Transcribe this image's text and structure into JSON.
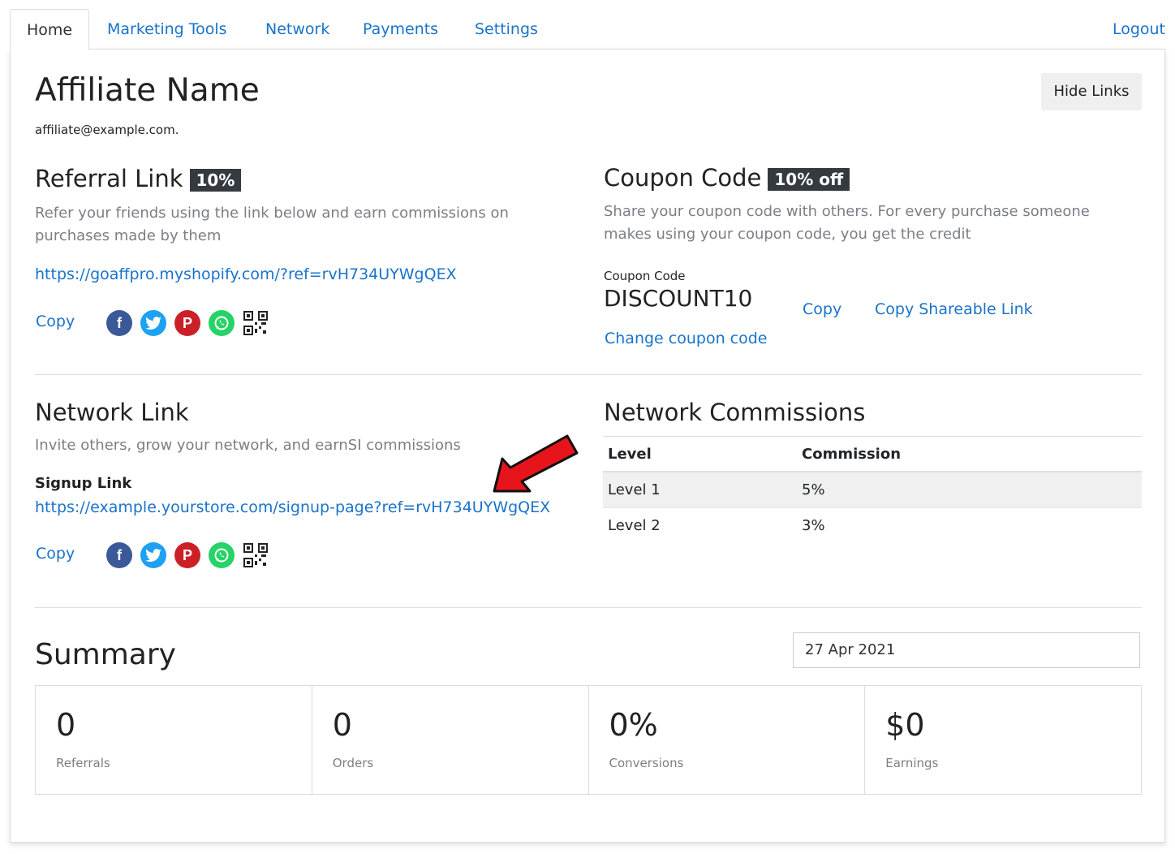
{
  "nav": {
    "tabs": [
      "Home",
      "Marketing Tools",
      "Network",
      "Payments",
      "Settings"
    ],
    "logout": "Logout"
  },
  "profile": {
    "name": "Affiliate Name",
    "email": "affiliate@example.com.",
    "hide_links": "Hide Links"
  },
  "referral": {
    "title": "Referral Link",
    "badge": "10%",
    "description": "Refer your friends using the link below and earn commissions on purchases made by them",
    "url": "https://goaffpro.myshopify.com/?ref=rvH734UYWgQEX",
    "copy": "Copy"
  },
  "coupon": {
    "title": "Coupon Code",
    "badge": "10% off",
    "description": "Share your coupon code with others. For every purchase someone makes using your coupon code, you get the credit",
    "label": "Coupon Code",
    "code": "DISCOUNT10",
    "copy": "Copy",
    "copy_shareable": "Copy Shareable Link",
    "change": "Change coupon code"
  },
  "network": {
    "title": "Network Link",
    "description": "Invite others, grow your network, and earnSI commissions",
    "signup_label": "Signup Link",
    "url": "https://example.yourstore.com/signup-page?ref=rvH734UYWgQEX",
    "copy": "Copy"
  },
  "commissions": {
    "title": "Network Commissions",
    "headers": [
      "Level",
      "Commission"
    ],
    "rows": [
      {
        "level": "Level 1",
        "commission": "5%"
      },
      {
        "level": "Level 2",
        "commission": "3%"
      }
    ]
  },
  "summary": {
    "title": "Summary",
    "date": "27 Apr 2021",
    "stats": [
      {
        "value": "0",
        "label": "Referrals"
      },
      {
        "value": "0",
        "label": "Orders"
      },
      {
        "value": "0%",
        "label": "Conversions"
      },
      {
        "value": "$0",
        "label": "Earnings"
      }
    ]
  },
  "share_icons": [
    "facebook-icon",
    "twitter-icon",
    "pinterest-icon",
    "whatsapp-icon",
    "qr-code-icon"
  ],
  "colors": {
    "link": "#1a73c9",
    "badge": "#343a40",
    "arrow": "#e8141b"
  }
}
